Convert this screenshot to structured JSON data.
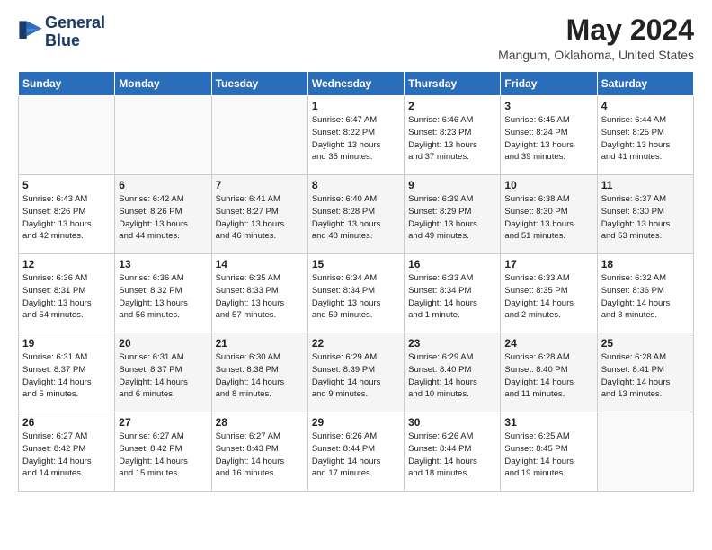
{
  "logo": {
    "line1": "General",
    "line2": "Blue"
  },
  "title": "May 2024",
  "location": "Mangum, Oklahoma, United States",
  "days_of_week": [
    "Sunday",
    "Monday",
    "Tuesday",
    "Wednesday",
    "Thursday",
    "Friday",
    "Saturday"
  ],
  "weeks": [
    [
      {
        "day": "",
        "info": ""
      },
      {
        "day": "",
        "info": ""
      },
      {
        "day": "",
        "info": ""
      },
      {
        "day": "1",
        "info": "Sunrise: 6:47 AM\nSunset: 8:22 PM\nDaylight: 13 hours\nand 35 minutes."
      },
      {
        "day": "2",
        "info": "Sunrise: 6:46 AM\nSunset: 8:23 PM\nDaylight: 13 hours\nand 37 minutes."
      },
      {
        "day": "3",
        "info": "Sunrise: 6:45 AM\nSunset: 8:24 PM\nDaylight: 13 hours\nand 39 minutes."
      },
      {
        "day": "4",
        "info": "Sunrise: 6:44 AM\nSunset: 8:25 PM\nDaylight: 13 hours\nand 41 minutes."
      }
    ],
    [
      {
        "day": "5",
        "info": "Sunrise: 6:43 AM\nSunset: 8:26 PM\nDaylight: 13 hours\nand 42 minutes."
      },
      {
        "day": "6",
        "info": "Sunrise: 6:42 AM\nSunset: 8:26 PM\nDaylight: 13 hours\nand 44 minutes."
      },
      {
        "day": "7",
        "info": "Sunrise: 6:41 AM\nSunset: 8:27 PM\nDaylight: 13 hours\nand 46 minutes."
      },
      {
        "day": "8",
        "info": "Sunrise: 6:40 AM\nSunset: 8:28 PM\nDaylight: 13 hours\nand 48 minutes."
      },
      {
        "day": "9",
        "info": "Sunrise: 6:39 AM\nSunset: 8:29 PM\nDaylight: 13 hours\nand 49 minutes."
      },
      {
        "day": "10",
        "info": "Sunrise: 6:38 AM\nSunset: 8:30 PM\nDaylight: 13 hours\nand 51 minutes."
      },
      {
        "day": "11",
        "info": "Sunrise: 6:37 AM\nSunset: 8:30 PM\nDaylight: 13 hours\nand 53 minutes."
      }
    ],
    [
      {
        "day": "12",
        "info": "Sunrise: 6:36 AM\nSunset: 8:31 PM\nDaylight: 13 hours\nand 54 minutes."
      },
      {
        "day": "13",
        "info": "Sunrise: 6:36 AM\nSunset: 8:32 PM\nDaylight: 13 hours\nand 56 minutes."
      },
      {
        "day": "14",
        "info": "Sunrise: 6:35 AM\nSunset: 8:33 PM\nDaylight: 13 hours\nand 57 minutes."
      },
      {
        "day": "15",
        "info": "Sunrise: 6:34 AM\nSunset: 8:34 PM\nDaylight: 13 hours\nand 59 minutes."
      },
      {
        "day": "16",
        "info": "Sunrise: 6:33 AM\nSunset: 8:34 PM\nDaylight: 14 hours\nand 1 minute."
      },
      {
        "day": "17",
        "info": "Sunrise: 6:33 AM\nSunset: 8:35 PM\nDaylight: 14 hours\nand 2 minutes."
      },
      {
        "day": "18",
        "info": "Sunrise: 6:32 AM\nSunset: 8:36 PM\nDaylight: 14 hours\nand 3 minutes."
      }
    ],
    [
      {
        "day": "19",
        "info": "Sunrise: 6:31 AM\nSunset: 8:37 PM\nDaylight: 14 hours\nand 5 minutes."
      },
      {
        "day": "20",
        "info": "Sunrise: 6:31 AM\nSunset: 8:37 PM\nDaylight: 14 hours\nand 6 minutes."
      },
      {
        "day": "21",
        "info": "Sunrise: 6:30 AM\nSunset: 8:38 PM\nDaylight: 14 hours\nand 8 minutes."
      },
      {
        "day": "22",
        "info": "Sunrise: 6:29 AM\nSunset: 8:39 PM\nDaylight: 14 hours\nand 9 minutes."
      },
      {
        "day": "23",
        "info": "Sunrise: 6:29 AM\nSunset: 8:40 PM\nDaylight: 14 hours\nand 10 minutes."
      },
      {
        "day": "24",
        "info": "Sunrise: 6:28 AM\nSunset: 8:40 PM\nDaylight: 14 hours\nand 11 minutes."
      },
      {
        "day": "25",
        "info": "Sunrise: 6:28 AM\nSunset: 8:41 PM\nDaylight: 14 hours\nand 13 minutes."
      }
    ],
    [
      {
        "day": "26",
        "info": "Sunrise: 6:27 AM\nSunset: 8:42 PM\nDaylight: 14 hours\nand 14 minutes."
      },
      {
        "day": "27",
        "info": "Sunrise: 6:27 AM\nSunset: 8:42 PM\nDaylight: 14 hours\nand 15 minutes."
      },
      {
        "day": "28",
        "info": "Sunrise: 6:27 AM\nSunset: 8:43 PM\nDaylight: 14 hours\nand 16 minutes."
      },
      {
        "day": "29",
        "info": "Sunrise: 6:26 AM\nSunset: 8:44 PM\nDaylight: 14 hours\nand 17 minutes."
      },
      {
        "day": "30",
        "info": "Sunrise: 6:26 AM\nSunset: 8:44 PM\nDaylight: 14 hours\nand 18 minutes."
      },
      {
        "day": "31",
        "info": "Sunrise: 6:25 AM\nSunset: 8:45 PM\nDaylight: 14 hours\nand 19 minutes."
      },
      {
        "day": "",
        "info": ""
      }
    ]
  ]
}
